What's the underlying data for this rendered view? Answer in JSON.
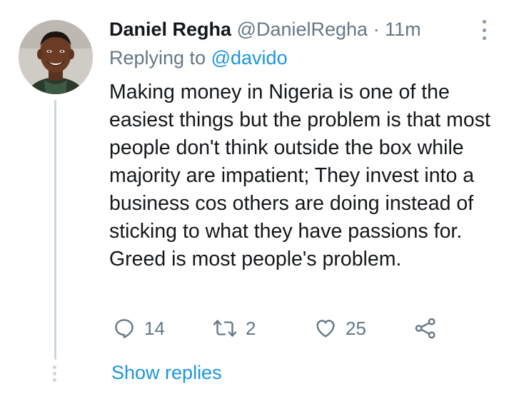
{
  "tweet": {
    "author_name": "Daniel Regha",
    "author_handle": "@DanielRegha",
    "separator": "·",
    "timestamp": "11m",
    "replying_prefix": "Replying to",
    "replying_to": "@davido",
    "text": "Making money in Nigeria is one of the easiest things but the problem is that most people don't think outside the box while majority are impatient; They invest into a business cos others are doing instead of sticking to what they have passions for. Greed is most people's problem.",
    "avatar_icon": "profile-photo"
  },
  "actions": {
    "reply_icon": "speech-bubble-icon",
    "reply_count": "14",
    "retweet_icon": "retweet-icon",
    "retweet_count": "2",
    "like_icon": "heart-icon",
    "like_count": "25",
    "share_icon": "share-icon"
  },
  "footer": {
    "show_replies_label": "Show replies"
  },
  "colors": {
    "text": "#14171a",
    "secondary": "#657786",
    "accent": "#1b95e0",
    "thread_line": "#ccd6dd"
  }
}
